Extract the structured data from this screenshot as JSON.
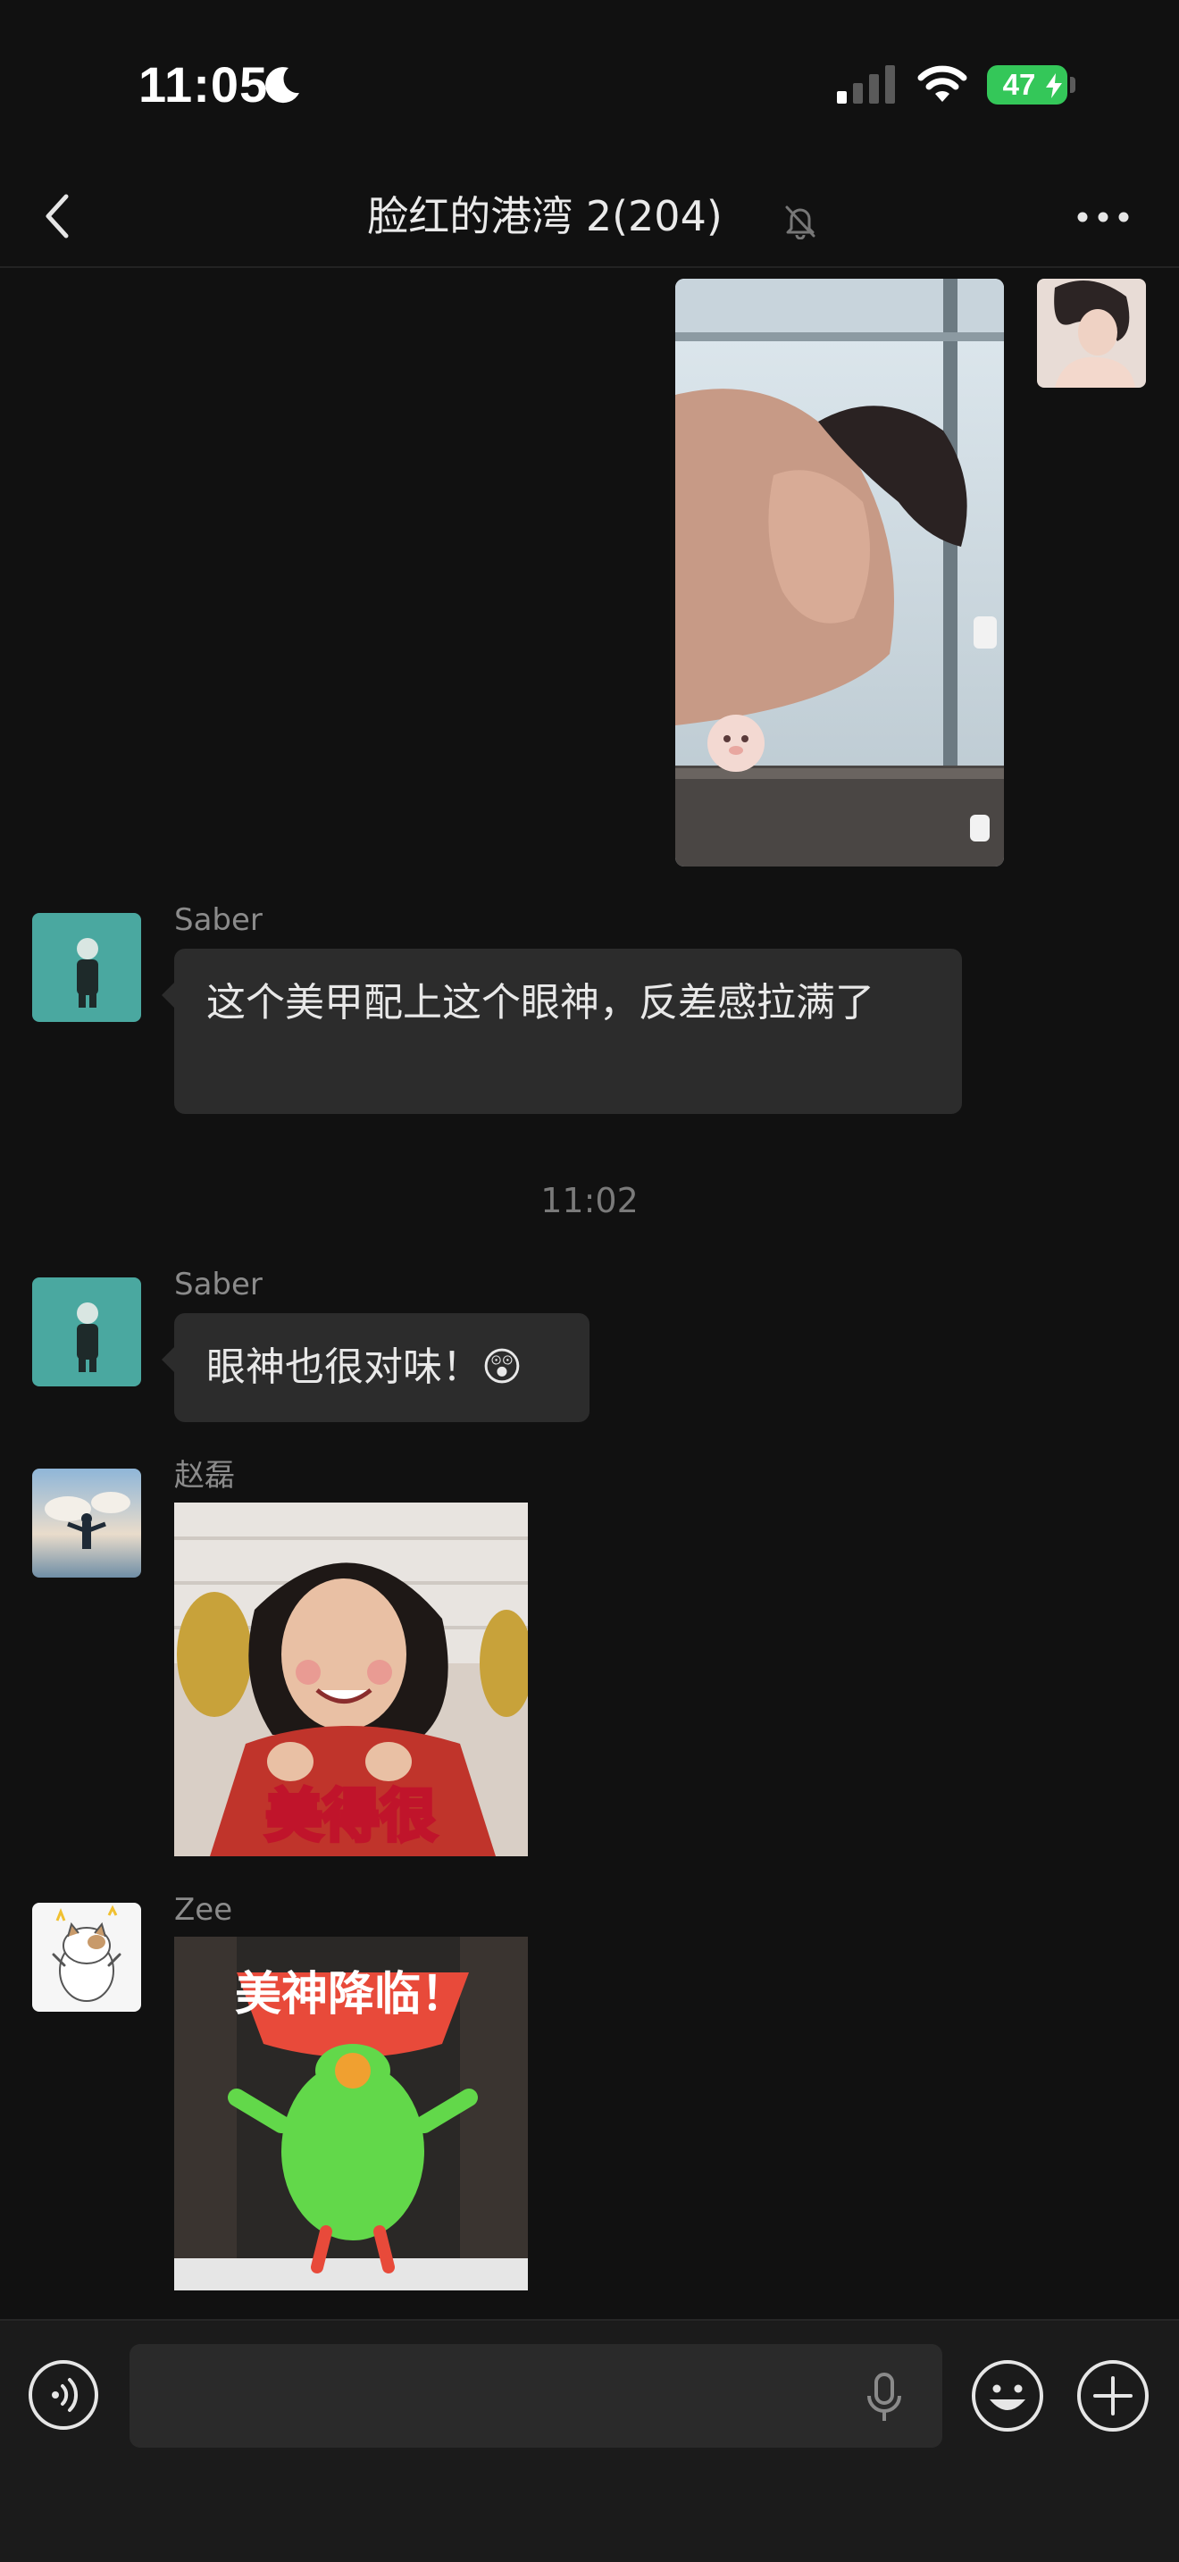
{
  "status_bar": {
    "time": "11:05",
    "battery": "47"
  },
  "header": {
    "title": "脸红的港湾 2(204)"
  },
  "messages": [
    {
      "type": "image",
      "sender": "",
      "side": "right"
    },
    {
      "type": "text",
      "sender": "Saber",
      "text": "这个美甲配上这个眼神，反差感拉满了"
    },
    {
      "type": "timestamp",
      "text": "11:02"
    },
    {
      "type": "text",
      "sender": "Saber",
      "text": "眼神也很对味！😲"
    },
    {
      "type": "sticker",
      "sender": "赵磊",
      "caption": "美得很"
    },
    {
      "type": "sticker",
      "sender": "Zee",
      "caption": "美神降临！"
    }
  ],
  "icons": {
    "moon": "moon-icon",
    "signal": "cellular-signal-icon",
    "wifi": "wifi-icon",
    "back": "chevron-left-icon",
    "mute": "bell-slash-icon",
    "more": "more-dots-icon",
    "voice": "voice-mode-icon",
    "mic": "microphone-icon",
    "emoji": "emoji-icon",
    "plus": "plus-icon"
  },
  "colors": {
    "background": "#111111",
    "bubble": "#2c2c2c",
    "battery": "#34c759",
    "avatar_teal": "#4aa8a0"
  },
  "input": {
    "placeholder": ""
  }
}
